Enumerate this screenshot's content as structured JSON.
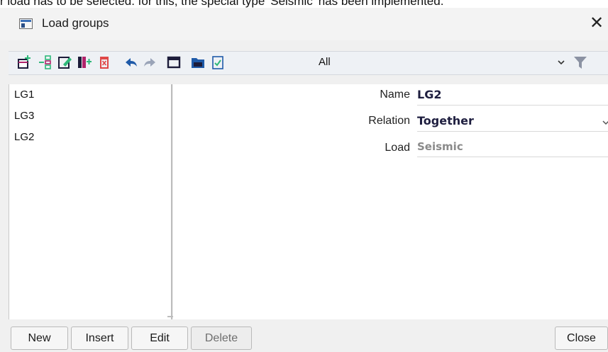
{
  "caption": "r load has to be selected. for this, the special type 'Seismic' has been implemented.",
  "window": {
    "title": "Load groups",
    "close_glyph": "✕"
  },
  "toolbar": {
    "icons": [
      "new-icon",
      "insert-icon",
      "edit-icon",
      "copy-icon",
      "delete-icon",
      "undo-icon",
      "redo-icon",
      "table-icon",
      "open-icon",
      "checklist-icon"
    ],
    "filter_value": "All",
    "colors": {
      "accent": "#1f5aa8",
      "danger": "#e04848",
      "green": "#2fb87a",
      "magenta": "#b0246b"
    }
  },
  "list": {
    "items": [
      {
        "label": "LG1",
        "selected": false
      },
      {
        "label": "LG3",
        "selected": false
      },
      {
        "label": "LG2",
        "selected": true
      }
    ]
  },
  "properties": {
    "name": {
      "label": "Name",
      "value": "LG2"
    },
    "relation": {
      "label": "Relation",
      "value": "Together"
    },
    "load": {
      "label": "Load",
      "value": "Seismic"
    }
  },
  "buttons": {
    "new": "New",
    "insert": "Insert",
    "edit": "Edit",
    "delete": "Delete",
    "close": "Close"
  }
}
